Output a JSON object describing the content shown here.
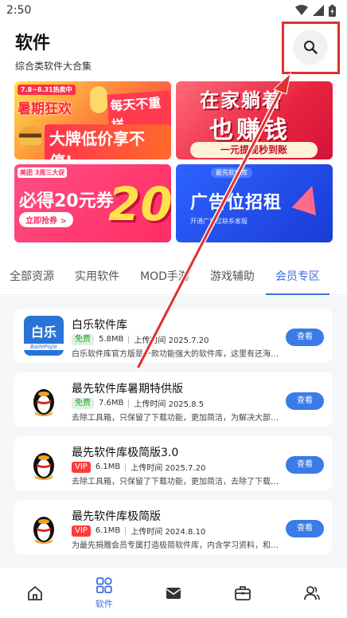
{
  "status_bar": {
    "time": "2:50"
  },
  "header": {
    "title": "软件",
    "subtitle": "综合类软件大合集"
  },
  "search": {
    "icon": "search-icon"
  },
  "banners": [
    {
      "tag": "7.8~8.31热卖中",
      "line1": "暑期狂欢",
      "line1b": "每天不重样",
      "line2": "大牌低价享不停!"
    },
    {
      "line1": "在家躺着",
      "line2": "也赚钱",
      "line3": "一元提现秒到账"
    },
    {
      "logo": "美团 3周三大促",
      "line1": "必得20元券",
      "button": "立即抢券 >",
      "big": "20"
    },
    {
      "top": "最先软件库",
      "line1": "广告位招租",
      "line2": "开通广告位联系客服"
    }
  ],
  "tabs": [
    {
      "label": "全部资源",
      "active": false
    },
    {
      "label": "实用软件",
      "active": false
    },
    {
      "label": "MOD手游",
      "active": false
    },
    {
      "label": "游戏辅助",
      "active": false
    },
    {
      "label": "会员专区",
      "active": true
    }
  ],
  "apps": [
    {
      "icon": "baile-logo-icon",
      "icon_zh": "白乐",
      "icon_en": "BailePojie",
      "name": "白乐软件库",
      "badge": "免费",
      "size": "5.8MB",
      "date": "上传时间 2025.7.20",
      "desc": "白乐软件库官方版是一款功能强大的软件库，这里有还海量的",
      "button": "查看"
    },
    {
      "icon": "penguin-icon",
      "name": "最先软件库暑期特供版",
      "badge": "免费",
      "size": "7.6MB",
      "date": "上传时间 2025.8.5",
      "desc": "去除工具箱，只保留了下载功能，更加简洁，为解决大部分用",
      "button": "查看"
    },
    {
      "icon": "penguin-icon",
      "name": "最先软件库极简版3.0",
      "badge": "VIP",
      "size": "6.1MB",
      "date": "上传时间 2025.7.20",
      "desc": "去除工具箱，只保留了下载功能，更加简洁，去除了下载时的",
      "button": "查看"
    },
    {
      "icon": "penguin-icon",
      "name": "最先软件库极简版",
      "badge": "VIP",
      "size": "6.1MB",
      "date": "上传时间 2024.8.10",
      "desc": "为最先捐赠会员专属打造极简软件库，内含学习资料，和各种",
      "button": "查看"
    }
  ],
  "bottom_nav": [
    {
      "icon": "home-icon",
      "label": ""
    },
    {
      "icon": "grid-icon",
      "label": "软件",
      "active": true
    },
    {
      "icon": "mail-icon",
      "label": ""
    },
    {
      "icon": "toolbox-icon",
      "label": ""
    },
    {
      "icon": "users-icon",
      "label": ""
    }
  ],
  "colors": {
    "accent": "#3b6fe0",
    "button": "#3b7be8",
    "annotation": "#e03030"
  }
}
